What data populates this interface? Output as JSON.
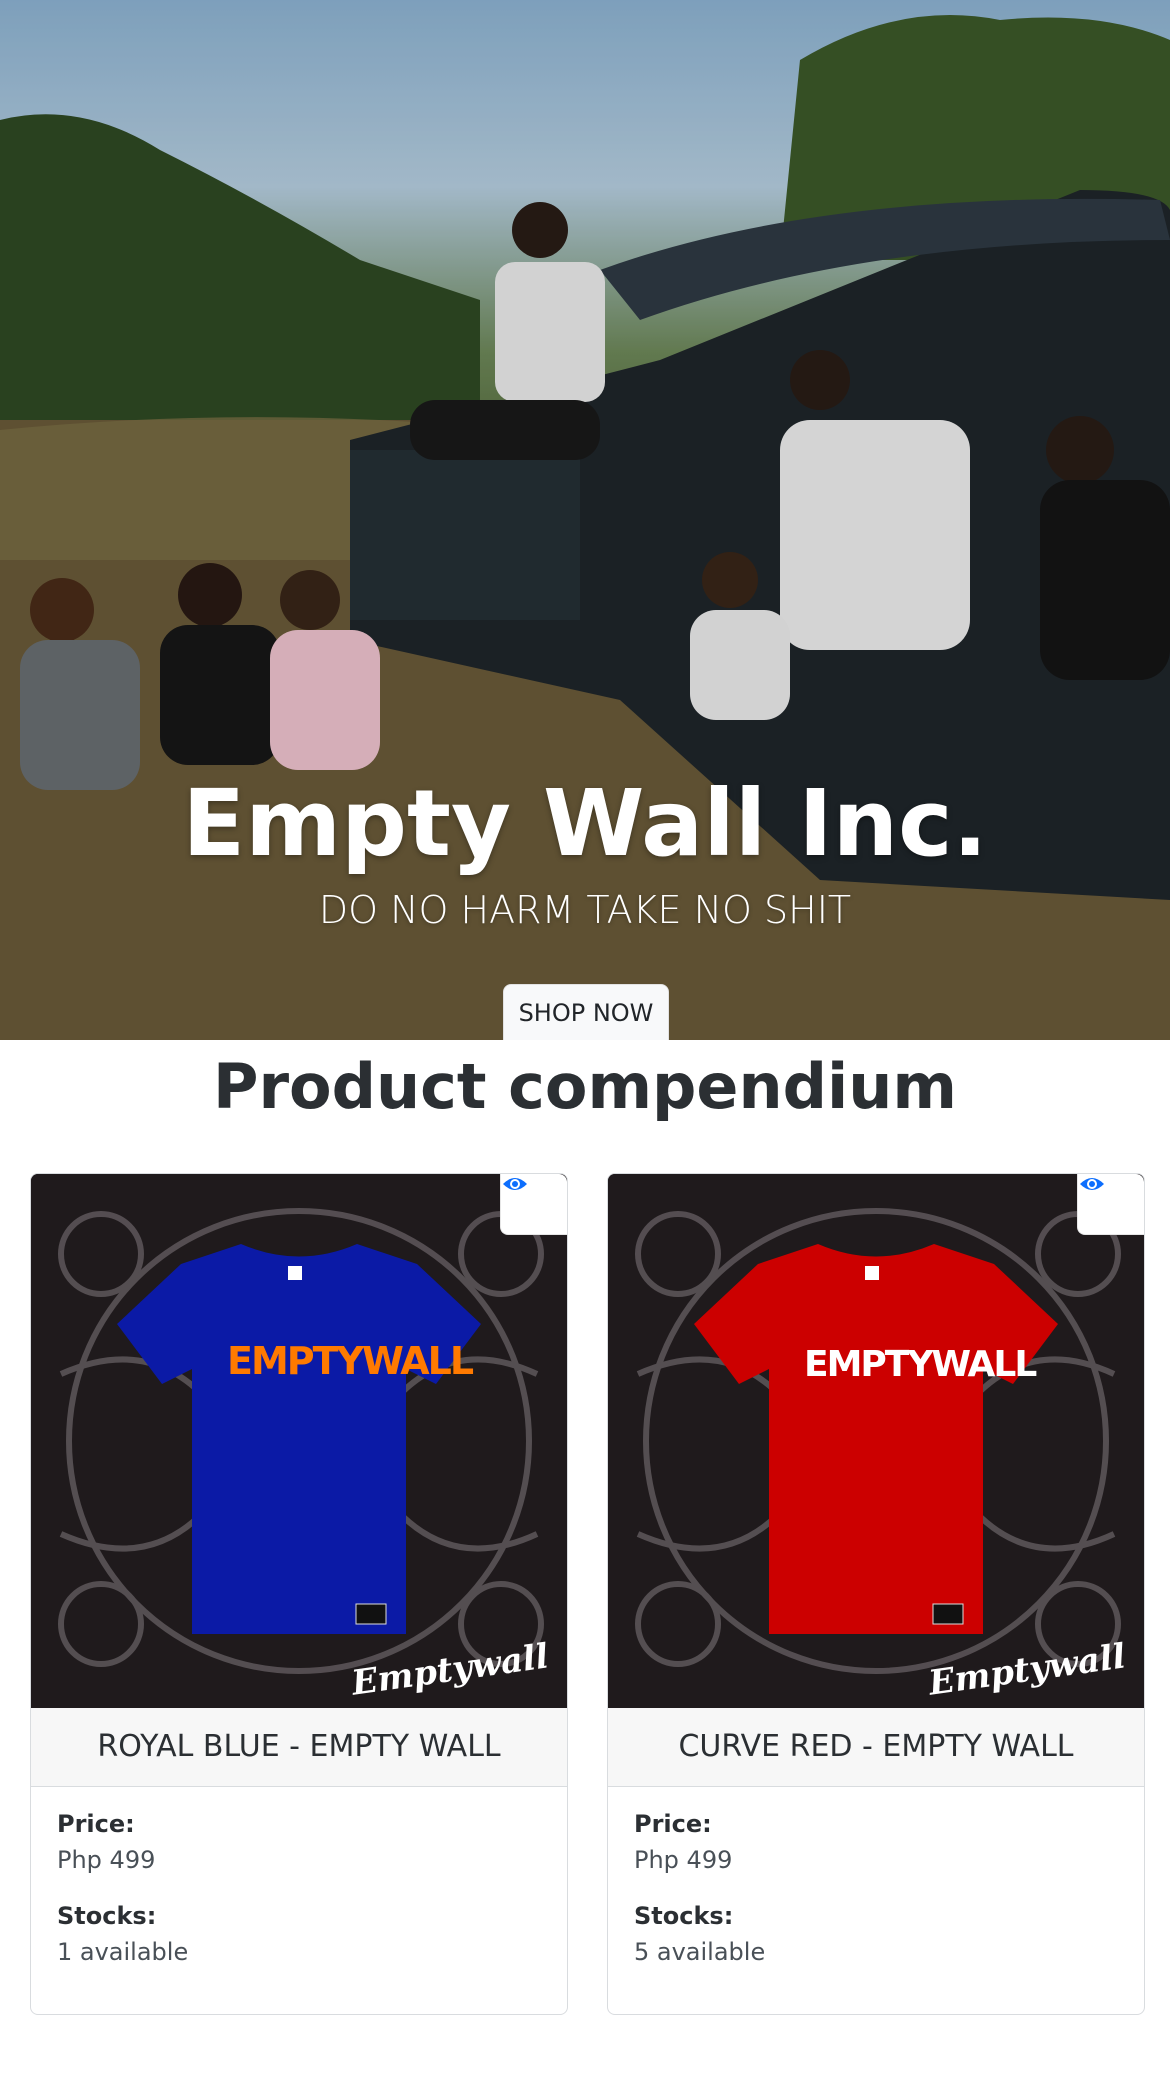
{
  "hero": {
    "title": "Empty Wall Inc.",
    "subtitle": "DO NO HARM TAKE NO SHIT",
    "cta_label": "SHOP NOW"
  },
  "section": {
    "title": "Product compendium"
  },
  "products": [
    {
      "name": "ROYAL BLUE - EMPTY WALL",
      "price_label": "Price:",
      "price": "Php 499",
      "stock_label": "Stocks:",
      "stock": "1 available",
      "shirt_color": "#0b1aa6",
      "print_text": "EMPTYWALL",
      "brand_mark": "Emptywall",
      "icon": "eye-icon"
    },
    {
      "name": "CURVE RED - EMPTY WALL",
      "price_label": "Price:",
      "price": "Php 499",
      "stock_label": "Stocks:",
      "stock": "5 available",
      "shirt_color": "#cc0000",
      "print_text": "EMPTYWALL",
      "brand_mark": "Emptywall",
      "icon": "eye-icon"
    }
  ],
  "colors": {
    "accent": "#0d6efd"
  }
}
